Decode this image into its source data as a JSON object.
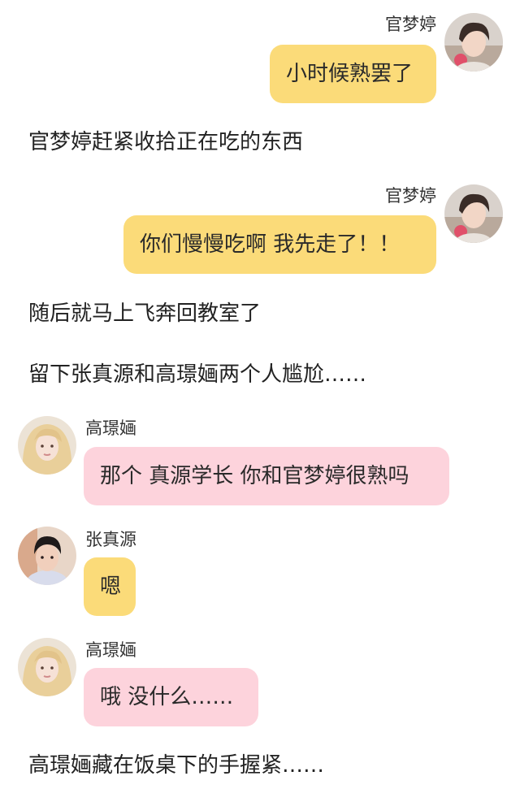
{
  "messages": [
    {
      "type": "message",
      "side": "right",
      "name": "官梦婷",
      "text": "小时候熟罢了",
      "bubble_color": "#fbdb79",
      "avatar": "guan-mengting-avatar"
    },
    {
      "type": "narration",
      "text": "官梦婷赶紧收拾正在吃的东西"
    },
    {
      "type": "message",
      "side": "right",
      "name": "官梦婷",
      "text": "你们慢慢吃啊 我先走了！！",
      "bubble_color": "#fbdb79",
      "avatar": "guan-mengting-avatar"
    },
    {
      "type": "narration",
      "text": "随后就马上飞奔回教室了"
    },
    {
      "type": "narration",
      "text": "留下张真源和高璟婳两个人尴尬……"
    },
    {
      "type": "message",
      "side": "left",
      "name": "高璟婳",
      "text": "那个 真源学长 你和官梦婷很熟吗",
      "bubble_color": "#fdd3dc",
      "avatar": "gao-jinghua-avatar"
    },
    {
      "type": "message",
      "side": "left",
      "name": "张真源",
      "text": "嗯",
      "bubble_color": "#fbdb79",
      "avatar": "zhang-zhenyuan-avatar"
    },
    {
      "type": "message",
      "side": "left",
      "name": "高璟婳",
      "text": "哦 没什么……",
      "bubble_color": "#fdd3dc",
      "avatar": "gao-jinghua-avatar"
    },
    {
      "type": "narration",
      "text": "高璟婳藏在饭桌下的手握紧……"
    }
  ]
}
